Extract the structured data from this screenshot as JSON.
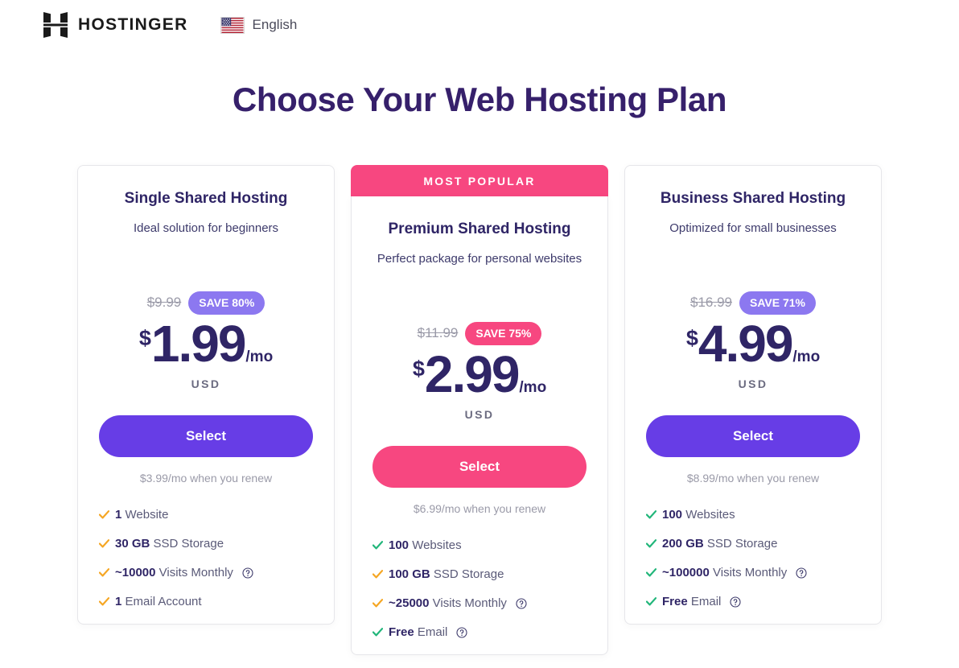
{
  "header": {
    "logo_icon": "hostinger-logo-icon",
    "brand_name": "HOSTINGER",
    "language": {
      "flag_icon": "us-flag-icon",
      "label": "English"
    }
  },
  "page_title": "Choose Your Web Hosting Plan",
  "colors": {
    "brand_purple": "#673de6",
    "accent_pink": "#f74780",
    "title_purple": "#36206b",
    "save_pill_purple": "#8c78f0",
    "check_green": "#21b67a",
    "check_orange": "#f5a623",
    "muted_gray": "#9a9aa8"
  },
  "plans": [
    {
      "badge": null,
      "name": "Single Shared Hosting",
      "description": "Ideal solution for beginners",
      "old_price": "$9.99",
      "save_label": "SAVE 80%",
      "save_color": "#8c78f0",
      "currency_symbol": "$",
      "price": "1.99",
      "per_period": "/mo",
      "currency_code": "USD",
      "cta_label": "Select",
      "cta_color": "#673de6",
      "renew_note": "$3.99/mo when you renew",
      "features": [
        {
          "strong": "1",
          "rest": "Website",
          "check_color": "#f5a623",
          "has_help": false
        },
        {
          "strong": "30 GB",
          "rest": "SSD Storage",
          "check_color": "#f5a623",
          "has_help": false
        },
        {
          "strong": "~10000",
          "rest": "Visits Monthly",
          "check_color": "#f5a623",
          "has_help": true
        },
        {
          "strong": "1",
          "rest": "Email Account",
          "check_color": "#f5a623",
          "has_help": false
        }
      ]
    },
    {
      "badge": "MOST POPULAR",
      "name": "Premium Shared Hosting",
      "description": "Perfect package for personal websites",
      "old_price": "$11.99",
      "save_label": "SAVE 75%",
      "save_color": "#f74780",
      "currency_symbol": "$",
      "price": "2.99",
      "per_period": "/mo",
      "currency_code": "USD",
      "cta_label": "Select",
      "cta_color": "#f74780",
      "renew_note": "$6.99/mo when you renew",
      "features": [
        {
          "strong": "100",
          "rest": "Websites",
          "check_color": "#21b67a",
          "has_help": false
        },
        {
          "strong": "100 GB",
          "rest": "SSD Storage",
          "check_color": "#f5a623",
          "has_help": false
        },
        {
          "strong": "~25000",
          "rest": "Visits Monthly",
          "check_color": "#f5a623",
          "has_help": true
        },
        {
          "strong": "Free",
          "rest": "Email",
          "check_color": "#21b67a",
          "has_help": true
        }
      ]
    },
    {
      "badge": null,
      "name": "Business Shared Hosting",
      "description": "Optimized for small businesses",
      "old_price": "$16.99",
      "save_label": "SAVE 71%",
      "save_color": "#8c78f0",
      "currency_symbol": "$",
      "price": "4.99",
      "per_period": "/mo",
      "currency_code": "USD",
      "cta_label": "Select",
      "cta_color": "#673de6",
      "renew_note": "$8.99/mo when you renew",
      "features": [
        {
          "strong": "100",
          "rest": "Websites",
          "check_color": "#21b67a",
          "has_help": false
        },
        {
          "strong": "200 GB",
          "rest": "SSD Storage",
          "check_color": "#21b67a",
          "has_help": false
        },
        {
          "strong": "~100000",
          "rest": "Visits Monthly",
          "check_color": "#21b67a",
          "has_help": true
        },
        {
          "strong": "Free",
          "rest": "Email",
          "check_color": "#21b67a",
          "has_help": true
        }
      ]
    }
  ]
}
